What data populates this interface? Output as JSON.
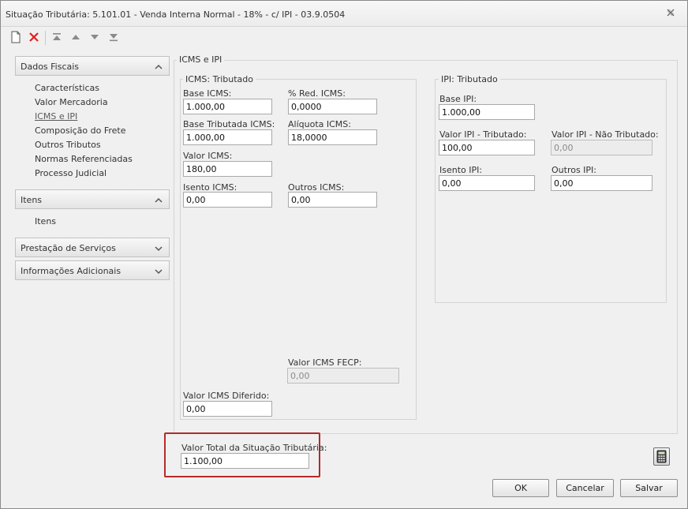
{
  "window": {
    "title": "Situação Tributária: 5.101.01 - Venda Interna Normal - 18% - c/ IPI - 03.9.0504",
    "close_icon": "close-icon"
  },
  "toolbar": {
    "icons": [
      "new-document-icon",
      "delete-icon",
      "move-first-icon",
      "move-up-icon",
      "move-down-icon",
      "move-last-icon"
    ]
  },
  "nav": {
    "groups": [
      {
        "label": "Dados Fiscais",
        "expanded": true,
        "items": [
          "Características",
          "Valor Mercadoria",
          "ICMS e IPI",
          "Composição do Frete",
          "Outros Tributos",
          "Normas Referenciadas",
          "Processo Judicial"
        ],
        "active_item": "ICMS e IPI"
      },
      {
        "label": "Itens",
        "expanded": true,
        "items": [
          "Itens"
        ]
      },
      {
        "label": "Prestação de Serviços",
        "expanded": false,
        "items": []
      },
      {
        "label": "Informações Adicionais",
        "expanded": false,
        "items": []
      }
    ]
  },
  "main": {
    "group_title": "ICMS e IPI",
    "icms": {
      "title": "ICMS: Tributado",
      "fields": [
        {
          "label": "Base ICMS:",
          "value": "1.000,00"
        },
        {
          "label": "% Red. ICMS:",
          "value": "0,0000"
        },
        {
          "label": "Base Tributada ICMS:",
          "value": "1.000,00"
        },
        {
          "label": "Alíquota ICMS:",
          "value": "18,0000"
        },
        {
          "label": "Valor ICMS:",
          "value": "180,00"
        },
        {
          "label": "Isento ICMS:",
          "value": "0,00"
        },
        {
          "label": "Outros ICMS:",
          "value": "0,00"
        },
        {
          "label": "Valor ICMS FECP:",
          "value": "0,00"
        },
        {
          "label": "Valor ICMS Diferido:",
          "value": "0,00"
        }
      ]
    },
    "ipi": {
      "title": "IPI: Tributado",
      "fields": [
        {
          "label": "Base IPI:",
          "value": "1.000,00"
        },
        {
          "label": "Valor IPI - Tributado:",
          "value": "100,00"
        },
        {
          "label": "Valor IPI - Não Tributado:",
          "value": "0,00"
        },
        {
          "label": "Isento IPI:",
          "value": "0,00"
        },
        {
          "label": "Outros IPI:",
          "value": "0,00"
        }
      ]
    }
  },
  "total": {
    "label": "Valor Total da Situação Tributária:",
    "value": "1.100,00"
  },
  "buttons": {
    "ok": "OK",
    "cancel": "Cancelar",
    "save": "Salvar",
    "calculator_icon": "calculator-icon"
  },
  "colors": {
    "highlight": "#b52a2a",
    "delete_icon": "#e02020",
    "window_bg": "#f0f0f0"
  }
}
